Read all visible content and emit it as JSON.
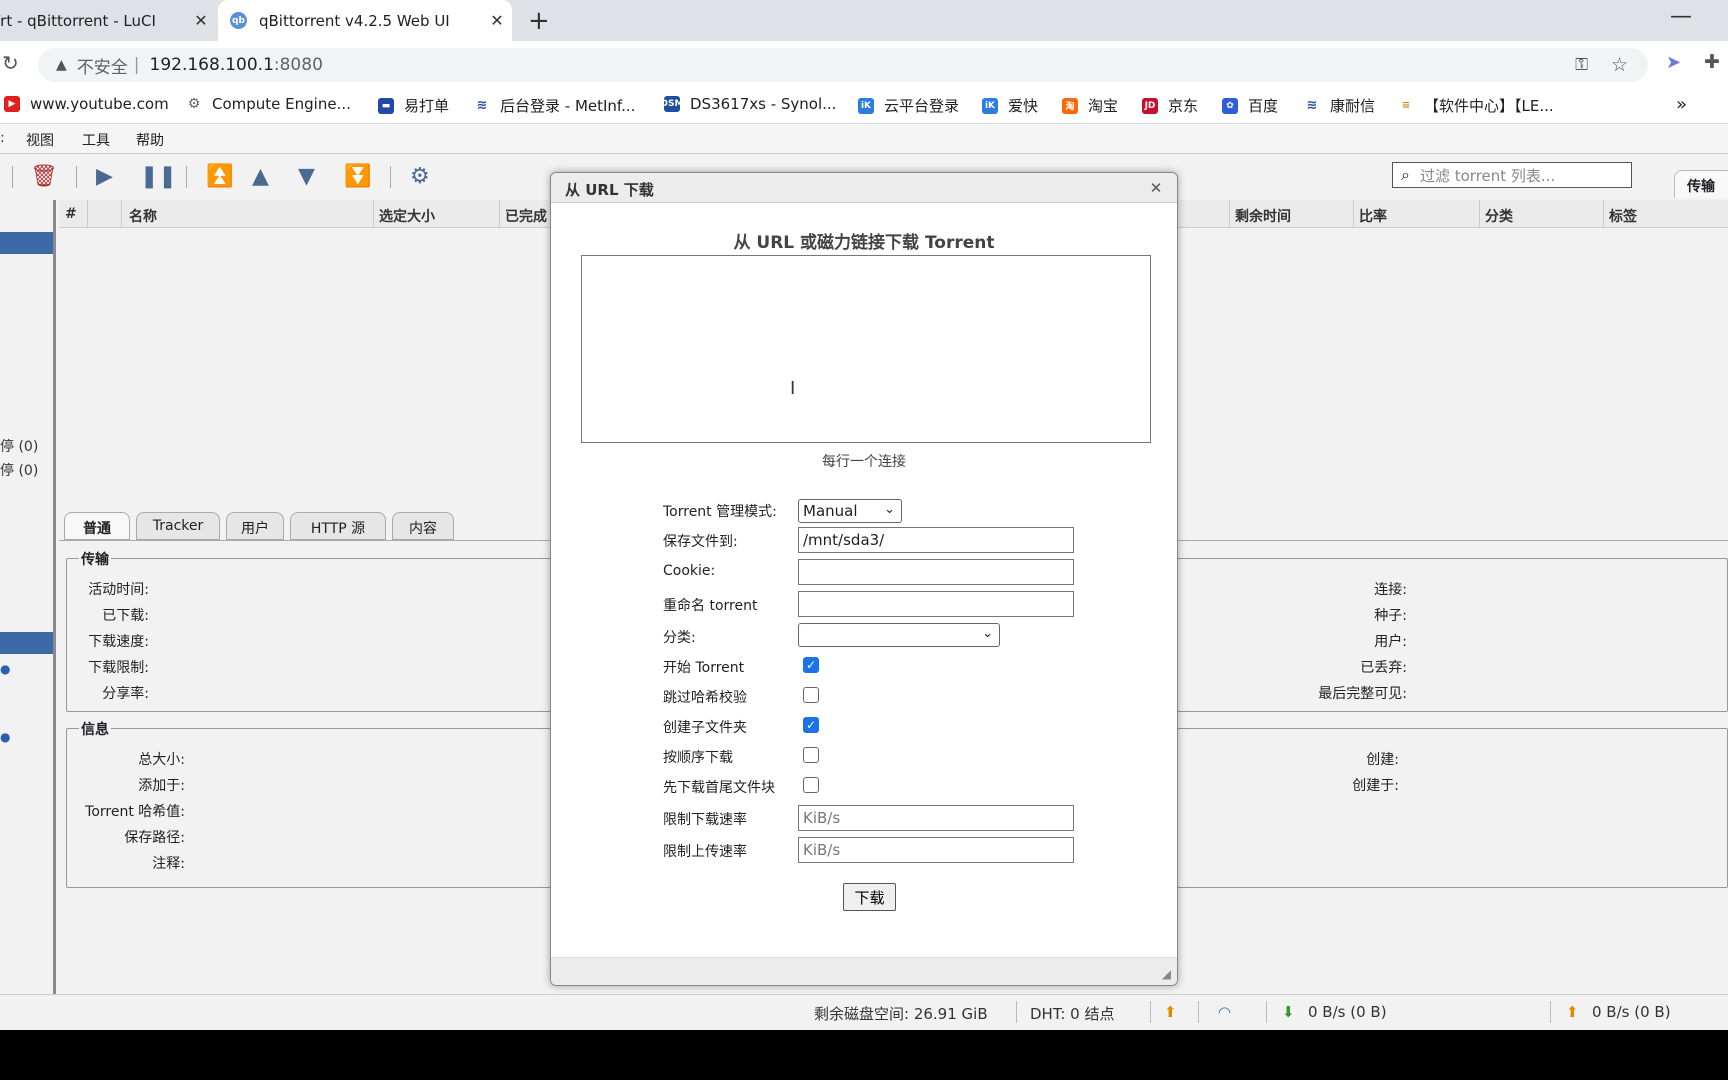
{
  "browser": {
    "tabs": [
      {
        "title": "Wrt - qBittorrent - LuCI"
      },
      {
        "title": "qBittorrent v4.2.5 Web UI",
        "favicon": "qb"
      }
    ],
    "address": {
      "insecure": "不安全",
      "host": "192.168.100.1",
      "port": ":8080"
    },
    "bookmarks": [
      "www.youtube.com",
      "Compute Engine...",
      "易打单",
      "后台登录 - MetInf...",
      "DS3617xs - Synol...",
      "云平台登录",
      "爱快",
      "淘宝",
      "京东",
      "百度",
      "康耐信",
      "【软件中心】【LE..."
    ],
    "bookmark_icons": [
      "DSM",
      "iK",
      "iK",
      "淘",
      "JD"
    ]
  },
  "menu": {
    "items": [
      "视图",
      "工具",
      "帮助"
    ]
  },
  "filter": {
    "placeholder": "过滤 torrent 列表..."
  },
  "right_tab": "传输",
  "sidebar": {
    "items": [
      "停 (0)",
      "停 (0)"
    ]
  },
  "grid": {
    "columns": [
      "#",
      "名称",
      "选定大小",
      "已完成",
      "剩余时间",
      "比率",
      "分类",
      "标签"
    ]
  },
  "detail_tabs": [
    "普通",
    "Tracker",
    "用户",
    "HTTP 源",
    "内容"
  ],
  "transfer": {
    "legend": "传输",
    "left_labels": [
      "活动时间:",
      "已下载:",
      "下载速度:",
      "下载限制:",
      "分享率:"
    ],
    "right_labels": [
      "连接:",
      "种子:",
      "用户:",
      "已丢弃:",
      "最后完整可见:"
    ]
  },
  "info": {
    "legend": "信息",
    "left_labels": [
      "总大小:",
      "添加于:",
      "Torrent 哈希值:",
      "保存路径:",
      "注释:"
    ],
    "right_labels": [
      "创建:",
      "创建于:"
    ]
  },
  "status": {
    "free_space": "剩余磁盘空间: 26.91 GiB",
    "dht": "DHT: 0 结点",
    "download": "0 B/s (0 B)",
    "upload": "0 B/s (0 B)"
  },
  "dialog": {
    "title": "从 URL 下载",
    "heading": "从 URL 或磁力链接下载 Torrent",
    "url_value": "",
    "hint": "每行一个连接",
    "mode_label": "Torrent 管理模式:",
    "mode_value": "Manual",
    "save_label": "保存文件到:",
    "save_value": "/mnt/sda3/",
    "cookie_label": "Cookie:",
    "cookie_value": "",
    "rename_label": "重命名 torrent",
    "rename_value": "",
    "category_label": "分类:",
    "category_value": "",
    "start_label": "开始 Torrent",
    "start_checked": true,
    "skip_label": "跳过哈希校验",
    "skip_checked": false,
    "subfolder_label": "创建子文件夹",
    "subfolder_checked": true,
    "sequential_label": "按顺序下载",
    "sequential_checked": false,
    "firstlast_label": "先下载首尾文件块",
    "firstlast_checked": false,
    "dl_limit_label": "限制下载速率",
    "dl_limit_placeholder": "KiB/s",
    "ul_limit_label": "限制上传速率",
    "ul_limit_placeholder": "KiB/s",
    "download_button": "下载"
  }
}
